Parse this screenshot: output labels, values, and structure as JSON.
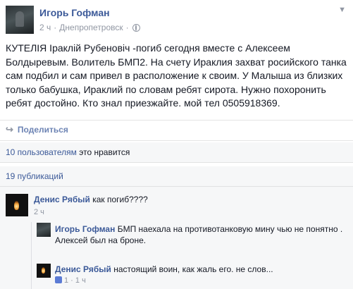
{
  "post": {
    "author": "Игорь Гофман",
    "time": "2 ч",
    "separator": "·",
    "location": "Днепропетровск",
    "text": "КУТЕЛІЯ Іраклій Рубеновіч -погиб сегодня вместе с Алексеем Болдыревым. Волитель БМП2. На счету Ираклия захват росийского танка сам подбил и сам привел в расположение к своим. У Малыша из близких только бабушка, Ираклий по словам ребят сирота. Нужно похоронить ребят достойно. Кто знал приезжайте. мой тел 0505918369."
  },
  "actions": {
    "share_label": "Поделиться"
  },
  "likes": {
    "count_link": "10 пользователям",
    "suffix": " это нравится"
  },
  "shares": {
    "label": "19 публикаций"
  },
  "comments": [
    {
      "author": "Денис Рябый",
      "text": "как погиб????",
      "time": "2 ч"
    },
    {
      "author": "Игорь Гофман",
      "text": "БМП наехала на противотанковую мину чью не понятно . Алексей был на броне.",
      "time": ""
    },
    {
      "author": "Денис Рябый",
      "text": "настоящий воин, как жаль его. не слов...",
      "likes": "1",
      "time": "1 ч"
    }
  ]
}
